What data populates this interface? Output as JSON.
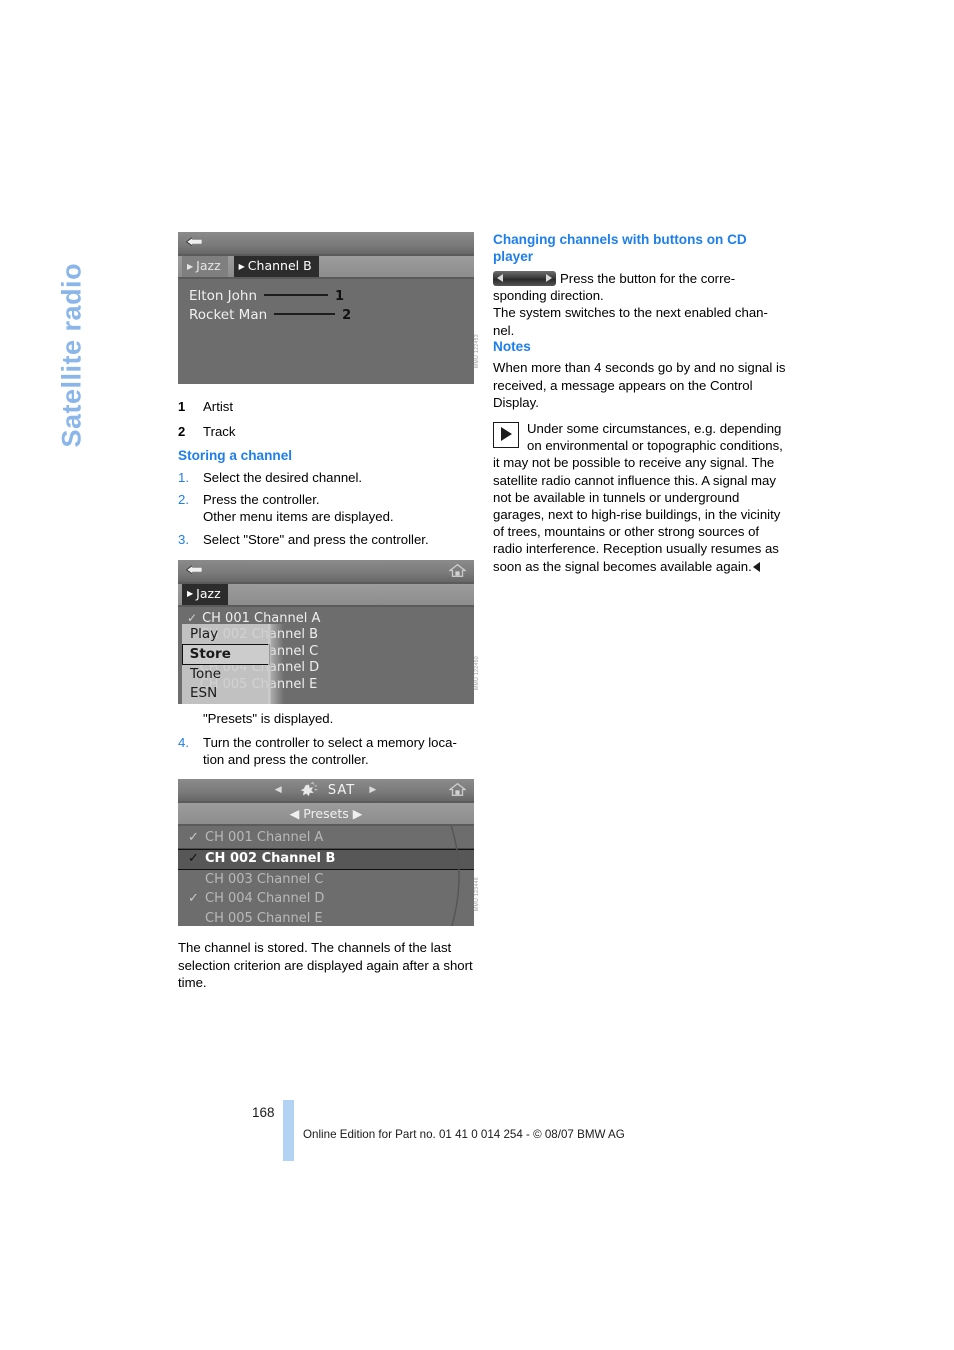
{
  "chapter_title": "Satellite radio",
  "page_number": "168",
  "footer_note": "Online Edition for Part no. 01 41 0 014 254 - © 08/07 BMW AG",
  "left_column": {
    "figure1": {
      "code": "MMU 122453",
      "back_icon": "back-arrow-icon",
      "crumbs": [
        {
          "label": "Jazz",
          "state": "dim"
        },
        {
          "label": "Channel B",
          "state": "selected"
        }
      ],
      "now_playing": [
        {
          "text": "Elton John",
          "number": "1"
        },
        {
          "text": "Rocket Man",
          "number": "2"
        }
      ]
    },
    "legend": [
      {
        "num": "1",
        "label": "Artist"
      },
      {
        "num": "2",
        "label": "Track"
      }
    ],
    "storing_heading": "Storing a channel",
    "steps": [
      {
        "num": "1.",
        "text": "Select the desired channel.",
        "sub": ""
      },
      {
        "num": "2.",
        "text": "Press the controller.",
        "sub": "Other menu items are displayed."
      },
      {
        "num": "3.",
        "text": "Select \"Store\" and press the controller.",
        "sub": ""
      }
    ],
    "figure2": {
      "code": "MMU 122450",
      "back_icon": "back-arrow-icon",
      "home_icon": "home-icon",
      "crumbs": [
        {
          "label": "Jazz",
          "state": "selected"
        }
      ],
      "channels": [
        {
          "tick": "✓",
          "label": "CH 001 Channel A"
        },
        {
          "tick": "",
          "label": "CH 002 Channel B"
        },
        {
          "tick": "",
          "label": "CH 003 Channel C"
        },
        {
          "tick": "",
          "label": "CH 004 Channel D"
        },
        {
          "tick": "",
          "label": "CH 005 Channel E"
        }
      ],
      "popup_menu": [
        {
          "label": "Play",
          "selected": false
        },
        {
          "label": "Store",
          "selected": true
        },
        {
          "label": "Tone",
          "selected": false
        },
        {
          "label": "ESN",
          "selected": false
        }
      ]
    },
    "presets_note": "\"Presets\" is displayed.",
    "step4": {
      "num": "4.",
      "text": "Turn the controller to select a memory loca-",
      "sub": "tion and press the controller."
    },
    "figure3": {
      "code": "MMU 123446",
      "sat_icon": "satellite-burst-icon",
      "sat_label": "SAT",
      "home_icon": "home-icon",
      "crumb": "Presets",
      "presets": [
        {
          "tick": "✓",
          "label": "CH 001 Channel A",
          "selected": false,
          "dim": true
        },
        {
          "tick": "✓",
          "label": "CH 002 Channel B",
          "selected": true,
          "dim": false
        },
        {
          "tick": "",
          "label": "CH 003 Channel C",
          "selected": false,
          "dim": true
        },
        {
          "tick": "✓",
          "label": "CH 004 Channel D",
          "selected": false,
          "dim": true
        },
        {
          "tick": "",
          "label": "CH 005 Channel E",
          "selected": false,
          "dim": true
        }
      ]
    },
    "closing_paragraph": "The channel is stored. The channels of the last selection criterion are displayed again after a short time."
  },
  "right_column": {
    "heading1": "Changing channels with buttons on CD player",
    "cd_button_icon": "cd-seek-button-icon",
    "para1_a": "Press the button for the corre-",
    "para1_b": "sponding direction.",
    "para1_c": "The system switches to the next enabled chan-",
    "para1_d": "nel.",
    "heading2": "Notes",
    "para2": "When more than 4 seconds go by and no signal is received, a message appears on the Control Display.",
    "note_icon": "note-triangle-icon",
    "para3": "Under some circumstances, e.g. depending on environmental or topographic conditions, it may not be possible to receive any signal. The satellite radio cannot influence this. A signal may not be available in tunnels or underground garages, next to high-rise buildings, in the vicinity of trees, mountains or other strong sources of radio interference. Reception usually resumes as soon as the signal becomes available again."
  },
  "colors": {
    "accent_blue": "#1f7fea",
    "chapter_blue": "#8ab6ea",
    "footer_bar_blue": "#b3d3f5",
    "screen_bg": "#6d6d6d"
  }
}
